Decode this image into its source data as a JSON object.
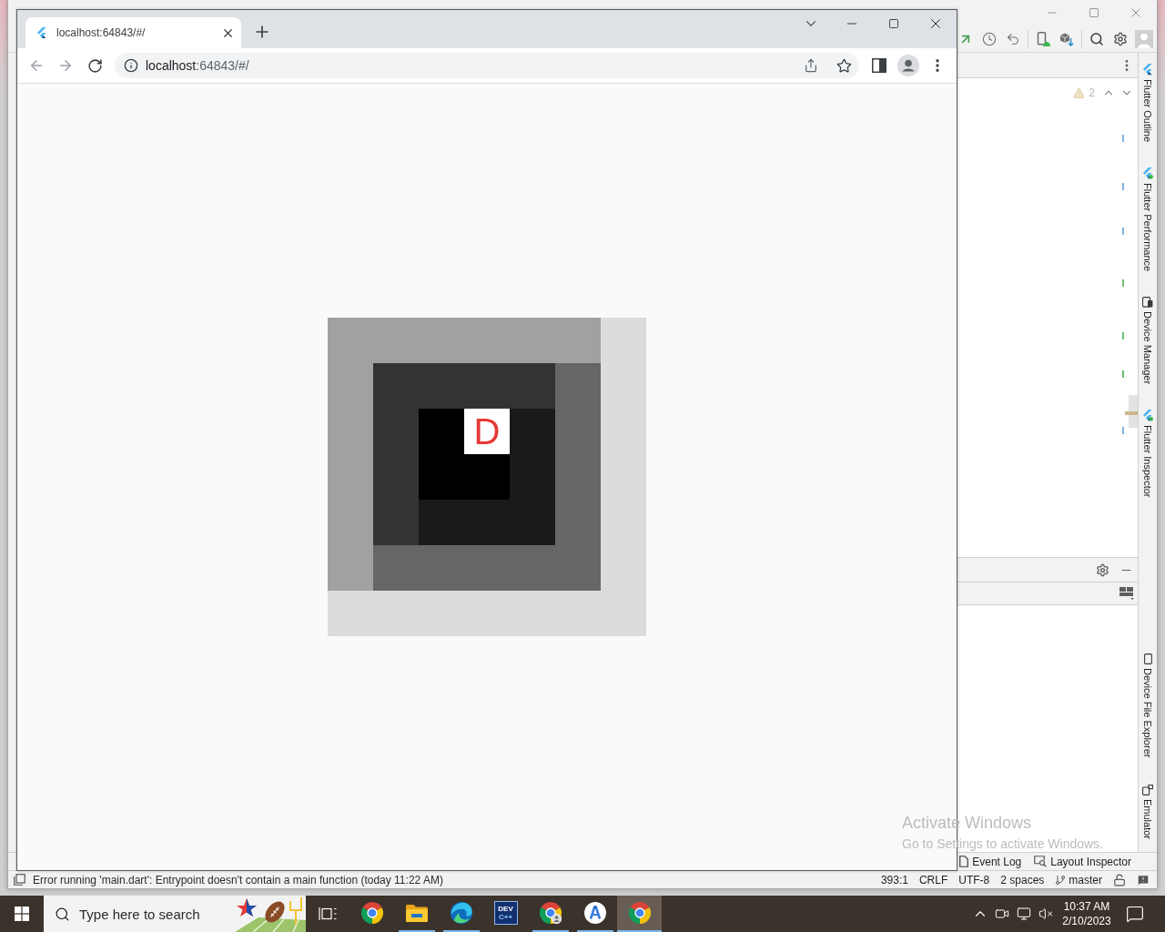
{
  "ide": {
    "editor": {
      "problems": {
        "count": "2"
      },
      "stripe_marks": [
        {
          "color": "#7fb2e5"
        },
        {
          "color": "#7fb2e5"
        },
        {
          "color": "#7fb2e5"
        },
        {
          "color": "#6cbf6f"
        },
        {
          "color": "#6cbf6f"
        },
        {
          "color": "#6cbf6f"
        },
        {
          "color": "#7fb2e5"
        }
      ]
    },
    "tool_windows_top": [
      {
        "label": "Flutter Outline"
      },
      {
        "label": "Flutter Performance"
      },
      {
        "label": "Device Manager"
      },
      {
        "label": "Flutter Inspector"
      }
    ],
    "tool_windows_bottom": [
      {
        "label": "Device File Explorer"
      },
      {
        "label": "Emulator"
      }
    ],
    "bottom_tools": [
      {
        "label": "Event Log"
      },
      {
        "label": "Layout Inspector"
      }
    ],
    "status_bar": {
      "message": "Error running 'main.dart': Entrypoint doesn't contain a main function (today 11:22 AM)",
      "position": "393:1",
      "line_separator": "CRLF",
      "encoding": "UTF-8",
      "indent": "2 spaces",
      "branch": "master"
    }
  },
  "browser": {
    "tabs": [
      {
        "title": "localhost:64843/#/",
        "selected": true
      }
    ],
    "address": {
      "host": "localhost",
      "rest": ":64843/#/"
    },
    "page": {
      "label": "D"
    }
  },
  "taskbar": {
    "search": {
      "placeholder": "Type here to search"
    },
    "apps": [
      {
        "selected": false,
        "running": false
      },
      {
        "selected": false,
        "running": true
      },
      {
        "selected": false,
        "running": true
      },
      {
        "selected": false,
        "running": false,
        "logo_lines": [
          "DEV",
          "C++"
        ]
      },
      {
        "selected": false,
        "running": true
      },
      {
        "selected": false,
        "running": true
      },
      {
        "selected": true,
        "running": true
      }
    ],
    "clock": {
      "time": "10:37 AM",
      "date": "2/10/2023"
    }
  },
  "activation_notice": {
    "title": "Activate Windows",
    "subtitle": "Go to Settings to activate Windows."
  }
}
